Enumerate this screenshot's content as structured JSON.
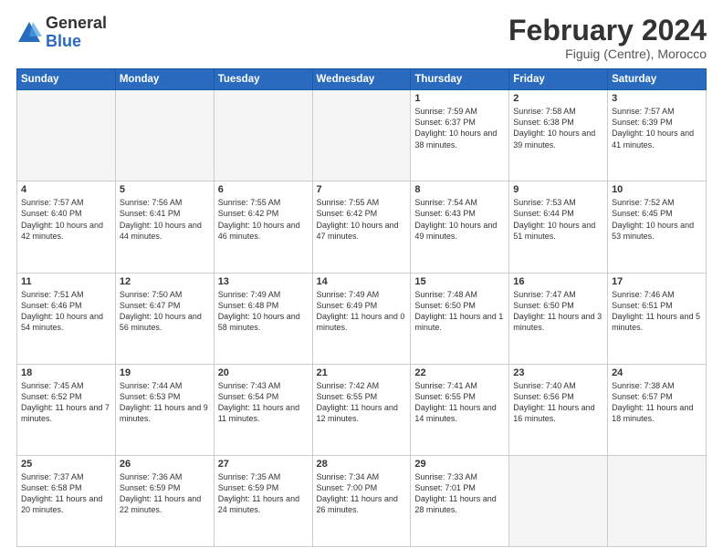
{
  "logo": {
    "general": "General",
    "blue": "Blue"
  },
  "title": {
    "month_year": "February 2024",
    "location": "Figuig (Centre), Morocco"
  },
  "weekdays": [
    "Sunday",
    "Monday",
    "Tuesday",
    "Wednesday",
    "Thursday",
    "Friday",
    "Saturday"
  ],
  "weeks": [
    [
      {
        "day": "",
        "info": ""
      },
      {
        "day": "",
        "info": ""
      },
      {
        "day": "",
        "info": ""
      },
      {
        "day": "",
        "info": ""
      },
      {
        "day": "1",
        "info": "Sunrise: 7:59 AM\nSunset: 6:37 PM\nDaylight: 10 hours\nand 38 minutes."
      },
      {
        "day": "2",
        "info": "Sunrise: 7:58 AM\nSunset: 6:38 PM\nDaylight: 10 hours\nand 39 minutes."
      },
      {
        "day": "3",
        "info": "Sunrise: 7:57 AM\nSunset: 6:39 PM\nDaylight: 10 hours\nand 41 minutes."
      }
    ],
    [
      {
        "day": "4",
        "info": "Sunrise: 7:57 AM\nSunset: 6:40 PM\nDaylight: 10 hours\nand 42 minutes."
      },
      {
        "day": "5",
        "info": "Sunrise: 7:56 AM\nSunset: 6:41 PM\nDaylight: 10 hours\nand 44 minutes."
      },
      {
        "day": "6",
        "info": "Sunrise: 7:55 AM\nSunset: 6:42 PM\nDaylight: 10 hours\nand 46 minutes."
      },
      {
        "day": "7",
        "info": "Sunrise: 7:55 AM\nSunset: 6:42 PM\nDaylight: 10 hours\nand 47 minutes."
      },
      {
        "day": "8",
        "info": "Sunrise: 7:54 AM\nSunset: 6:43 PM\nDaylight: 10 hours\nand 49 minutes."
      },
      {
        "day": "9",
        "info": "Sunrise: 7:53 AM\nSunset: 6:44 PM\nDaylight: 10 hours\nand 51 minutes."
      },
      {
        "day": "10",
        "info": "Sunrise: 7:52 AM\nSunset: 6:45 PM\nDaylight: 10 hours\nand 53 minutes."
      }
    ],
    [
      {
        "day": "11",
        "info": "Sunrise: 7:51 AM\nSunset: 6:46 PM\nDaylight: 10 hours\nand 54 minutes."
      },
      {
        "day": "12",
        "info": "Sunrise: 7:50 AM\nSunset: 6:47 PM\nDaylight: 10 hours\nand 56 minutes."
      },
      {
        "day": "13",
        "info": "Sunrise: 7:49 AM\nSunset: 6:48 PM\nDaylight: 10 hours\nand 58 minutes."
      },
      {
        "day": "14",
        "info": "Sunrise: 7:49 AM\nSunset: 6:49 PM\nDaylight: 11 hours\nand 0 minutes."
      },
      {
        "day": "15",
        "info": "Sunrise: 7:48 AM\nSunset: 6:50 PM\nDaylight: 11 hours\nand 1 minute."
      },
      {
        "day": "16",
        "info": "Sunrise: 7:47 AM\nSunset: 6:50 PM\nDaylight: 11 hours\nand 3 minutes."
      },
      {
        "day": "17",
        "info": "Sunrise: 7:46 AM\nSunset: 6:51 PM\nDaylight: 11 hours\nand 5 minutes."
      }
    ],
    [
      {
        "day": "18",
        "info": "Sunrise: 7:45 AM\nSunset: 6:52 PM\nDaylight: 11 hours\nand 7 minutes."
      },
      {
        "day": "19",
        "info": "Sunrise: 7:44 AM\nSunset: 6:53 PM\nDaylight: 11 hours\nand 9 minutes."
      },
      {
        "day": "20",
        "info": "Sunrise: 7:43 AM\nSunset: 6:54 PM\nDaylight: 11 hours\nand 11 minutes."
      },
      {
        "day": "21",
        "info": "Sunrise: 7:42 AM\nSunset: 6:55 PM\nDaylight: 11 hours\nand 12 minutes."
      },
      {
        "day": "22",
        "info": "Sunrise: 7:41 AM\nSunset: 6:55 PM\nDaylight: 11 hours\nand 14 minutes."
      },
      {
        "day": "23",
        "info": "Sunrise: 7:40 AM\nSunset: 6:56 PM\nDaylight: 11 hours\nand 16 minutes."
      },
      {
        "day": "24",
        "info": "Sunrise: 7:38 AM\nSunset: 6:57 PM\nDaylight: 11 hours\nand 18 minutes."
      }
    ],
    [
      {
        "day": "25",
        "info": "Sunrise: 7:37 AM\nSunset: 6:58 PM\nDaylight: 11 hours\nand 20 minutes."
      },
      {
        "day": "26",
        "info": "Sunrise: 7:36 AM\nSunset: 6:59 PM\nDaylight: 11 hours\nand 22 minutes."
      },
      {
        "day": "27",
        "info": "Sunrise: 7:35 AM\nSunset: 6:59 PM\nDaylight: 11 hours\nand 24 minutes."
      },
      {
        "day": "28",
        "info": "Sunrise: 7:34 AM\nSunset: 7:00 PM\nDaylight: 11 hours\nand 26 minutes."
      },
      {
        "day": "29",
        "info": "Sunrise: 7:33 AM\nSunset: 7:01 PM\nDaylight: 11 hours\nand 28 minutes."
      },
      {
        "day": "",
        "info": ""
      },
      {
        "day": "",
        "info": ""
      }
    ]
  ]
}
